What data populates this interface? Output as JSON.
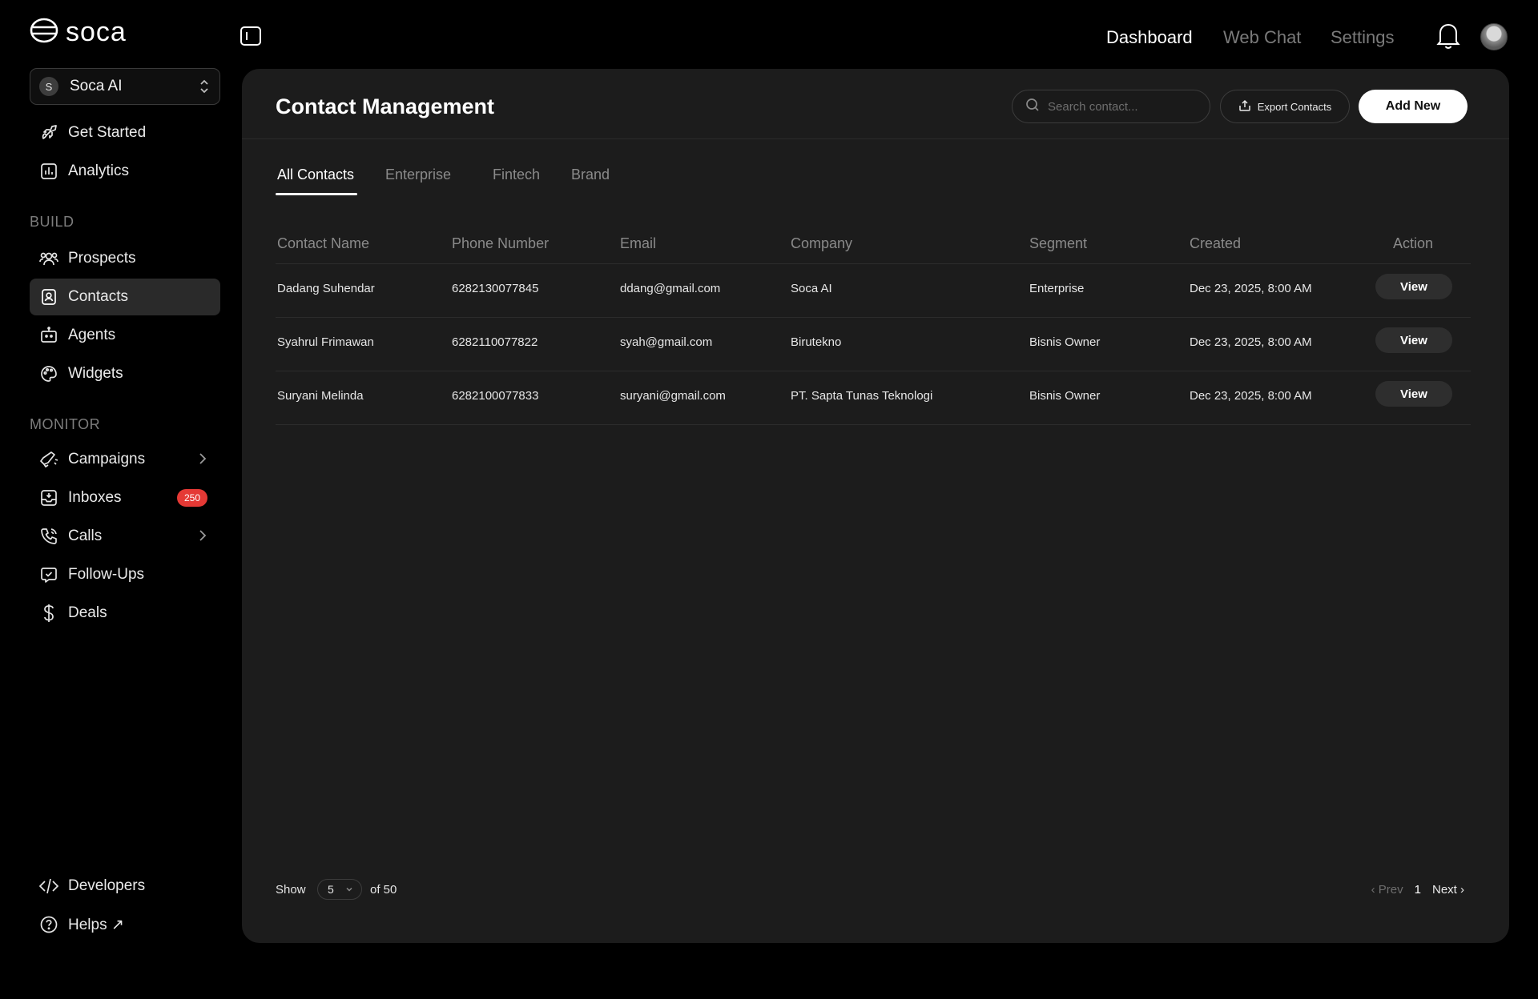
{
  "app": {
    "logo_text": "soca"
  },
  "workspace": {
    "avatar_letter": "S",
    "name": "Soca AI"
  },
  "sidebar": {
    "top_items": [
      {
        "label": "Get Started",
        "icon": "rocket-icon"
      },
      {
        "label": "Analytics",
        "icon": "chart-icon"
      }
    ],
    "build_label": "BUILD",
    "build_items": [
      {
        "label": "Prospects",
        "icon": "users-icon"
      },
      {
        "label": "Contacts",
        "icon": "contacts-icon",
        "active": true
      },
      {
        "label": "Agents",
        "icon": "bot-icon"
      },
      {
        "label": "Widgets",
        "icon": "palette-icon"
      }
    ],
    "monitor_label": "MONITOR",
    "monitor_items": [
      {
        "label": "Campaigns",
        "icon": "megaphone-icon",
        "has_chevron": true
      },
      {
        "label": "Inboxes",
        "icon": "inbox-icon",
        "badge": "250"
      },
      {
        "label": "Calls",
        "icon": "phone-icon",
        "has_chevron": true
      },
      {
        "label": "Follow-Ups",
        "icon": "check-message-icon"
      },
      {
        "label": "Deals",
        "icon": "dollar-icon"
      }
    ],
    "bottom_items": [
      {
        "label": "Developers",
        "icon": "code-icon"
      },
      {
        "label": "Helps ↗",
        "icon": "help-icon"
      }
    ]
  },
  "topbar": {
    "nav": [
      {
        "label": "Dashboard",
        "active": true
      },
      {
        "label": "Web Chat",
        "active": false
      },
      {
        "label": "Settings",
        "active": false
      }
    ]
  },
  "main": {
    "title": "Contact Management",
    "search": {
      "placeholder": "Search contact..."
    },
    "export_label": "Export Contacts",
    "add_label": "Add New",
    "tabs": [
      "All Contacts",
      "Enterprise",
      "Fintech",
      "Brand"
    ],
    "active_tab": "All Contacts",
    "columns": [
      "Contact Name",
      "Phone Number",
      "Email",
      "Company",
      "Segment",
      "Created",
      "Action"
    ],
    "rows": [
      {
        "name": "Dadang Suhendar",
        "phone": "6282130077845",
        "email": "ddang@gmail.com",
        "company": "Soca AI",
        "segment": "Enterprise",
        "created": "Dec 23, 2025, 8:00 AM",
        "action": "View"
      },
      {
        "name": "Syahrul Frimawan",
        "phone": "6282110077822",
        "email": "syah@gmail.com",
        "company": "Birutekno",
        "segment": "Bisnis Owner",
        "created": "Dec 23, 2025, 8:00 AM",
        "action": "View"
      },
      {
        "name": "Suryani Melinda",
        "phone": "6282100077833",
        "email": "suryani@gmail.com",
        "company": "PT. Sapta Tunas Teknologi",
        "segment": "Bisnis Owner",
        "created": "Dec 23, 2025, 8:00 AM",
        "action": "View"
      }
    ],
    "footer": {
      "show_label": "Show",
      "page_size": "5",
      "of_label": "of 50",
      "prev_label": "Prev",
      "current_page": "1",
      "next_label": "Next"
    }
  },
  "colors": {
    "background": "#000000",
    "panel": "#1c1c1c",
    "active_nav": "#2a2a2a",
    "badge": "#e53935",
    "primary_button": "#ffffff"
  }
}
